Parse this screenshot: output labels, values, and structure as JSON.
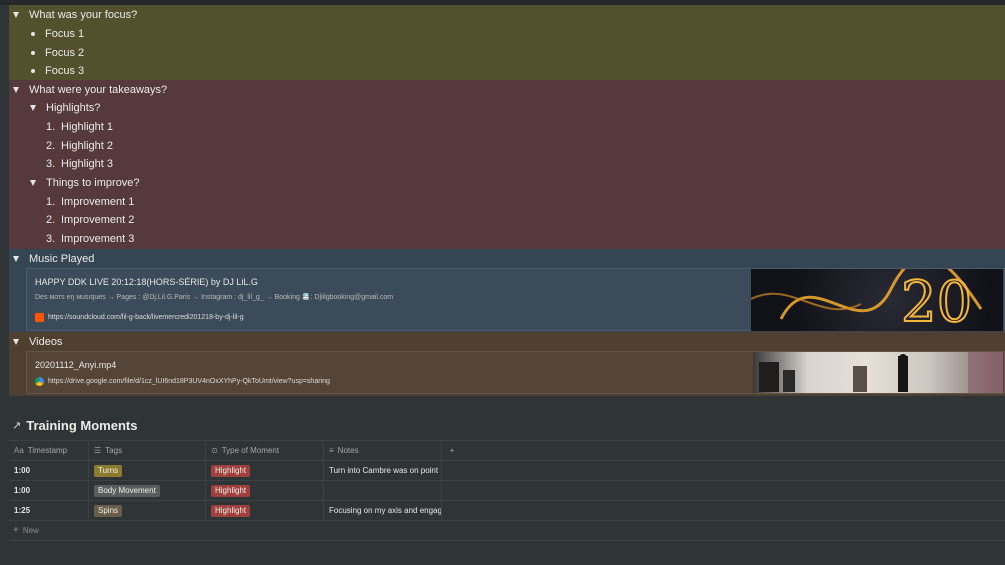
{
  "focus": {
    "heading": "What was your focus?",
    "items": [
      "Focus 1",
      "Focus 2",
      "Focus 3"
    ]
  },
  "takeaways": {
    "heading": "What were your takeaways?",
    "highlights": {
      "heading": "Highlights?",
      "items": [
        "Highlight 1",
        "Highlight 2",
        "Highlight 3"
      ]
    },
    "improve": {
      "heading": "Things to improve?",
      "items": [
        "Improvement 1",
        "Improvement 2",
        "Improvement 3"
      ]
    },
    "numbers": [
      "1.",
      "2.",
      "3."
    ]
  },
  "music": {
    "heading": "Music Played",
    "embed": {
      "title": "HAPPY DDK LIVE 20:12:18(HORS-SÉRIE) by DJ LiL.G",
      "description": "Des мотs eη мusıques   → Pages : @Dj.Lil.G.Paris → Instagram : dj_lil_g_ → Booking 📇: Djlilgbooking@gmail.com",
      "url": "https://soundcloud.com/lil-g-back/livemercredi201218-by-dj-lil-g",
      "thumb_text": "20"
    }
  },
  "videos": {
    "heading": "Videos",
    "embed": {
      "title": "20201112_Anyi.mp4",
      "url": "https://drive.google.com/file/d/1cz_lUI6nd18P3UV4nOxXYhPy-QkToUmt/view?usp=sharing"
    }
  },
  "training": {
    "title": "Training Moments",
    "columns": [
      "Timestamp",
      "Tags",
      "Type of Moment",
      "Notes"
    ],
    "rows": [
      {
        "timestamp": "1:00",
        "tag": "Turns",
        "moment": "Highlight",
        "notes": "Turn into Cambre was on point"
      },
      {
        "timestamp": "1:00",
        "tag": "Body Movement",
        "moment": "Highlight",
        "notes": ""
      },
      {
        "timestamp": "1:25",
        "tag": "Spins",
        "moment": "Highlight",
        "notes": "Focusing on my axis and engaging"
      }
    ],
    "new_label": "New",
    "add_col": "+"
  },
  "colors": {
    "tag_turns": "#8c7a2f",
    "tag_body": "#5a5c5e",
    "tag_spins": "#6a5e4a",
    "moment_highlight": "#a0403e"
  }
}
